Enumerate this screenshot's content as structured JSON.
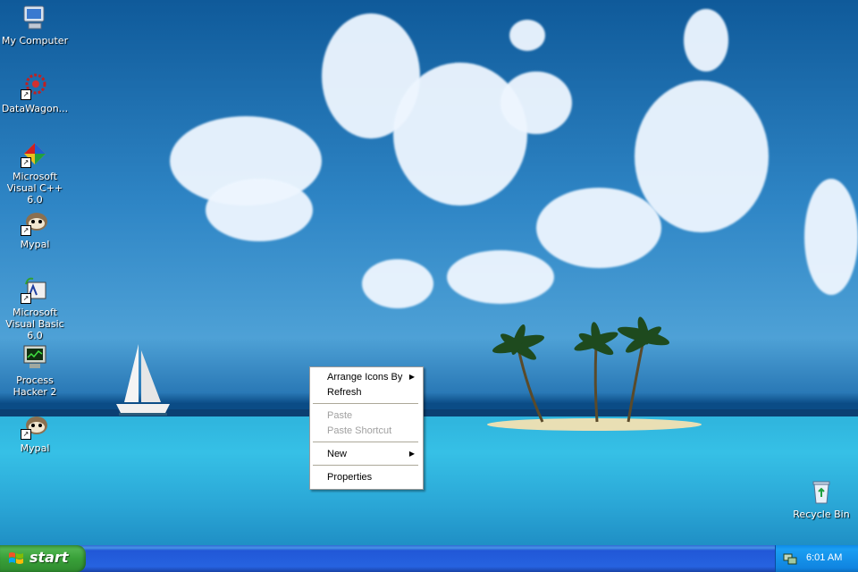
{
  "desktop": {
    "icons": [
      {
        "label": "My Computer",
        "icon": "my-computer-icon"
      },
      {
        "label": "DataWagon...",
        "icon": "datawagon-icon"
      },
      {
        "label": "Microsoft Visual C++ 6.0",
        "icon": "visual-cpp-icon"
      },
      {
        "label": "Mypal",
        "icon": "mypal-icon"
      },
      {
        "label": "Microsoft Visual Basic 6.0",
        "icon": "visual-basic-icon"
      },
      {
        "label": "Process Hacker 2",
        "icon": "process-hacker-icon"
      },
      {
        "label": "Mypal",
        "icon": "mypal-icon"
      }
    ],
    "recycle_bin": {
      "label": "Recycle Bin",
      "icon": "recycle-bin-icon"
    }
  },
  "context_menu": {
    "items": [
      {
        "label": "Arrange Icons By",
        "submenu": true,
        "enabled": true
      },
      {
        "label": "Refresh",
        "submenu": false,
        "enabled": true
      },
      {
        "label": "Paste",
        "submenu": false,
        "enabled": false
      },
      {
        "label": "Paste Shortcut",
        "submenu": false,
        "enabled": false
      },
      {
        "label": "New",
        "submenu": true,
        "enabled": true
      },
      {
        "label": "Properties",
        "submenu": false,
        "enabled": true
      }
    ],
    "submenu_arrow": "▶"
  },
  "taskbar": {
    "start_label": "start",
    "clock": "6:01 AM"
  },
  "colors": {
    "taskbar_blue": "#2663e0",
    "start_green": "#39a039",
    "tray_blue": "#1084e0"
  }
}
